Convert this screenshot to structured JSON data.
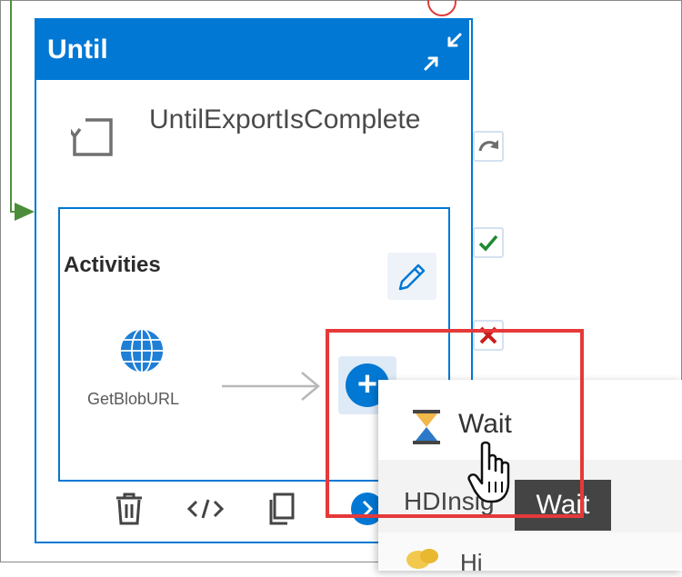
{
  "card": {
    "header_title": "Until",
    "activity_name": "UntilExportIsComplete",
    "activities_heading": "Activities",
    "inner_activity_label": "GetBlobURL"
  },
  "menu": {
    "items": [
      {
        "label": "Wait",
        "icon": "hourglass-icon"
      },
      {
        "label": "HDInsig",
        "icon": "hdinsight-icon"
      },
      {
        "label": "Hi",
        "icon": "hive-icon"
      }
    ],
    "tooltip": "Wait"
  },
  "colors": {
    "accent": "#0078d4",
    "flow_green": "#4b8d3a",
    "highlight_red": "#e5393a"
  },
  "icons": {
    "collapse": "collapse-icon",
    "loop": "loop-icon",
    "edit": "pencil-icon",
    "activity": "globe-icon",
    "add": "plus-icon",
    "footer": [
      "trash-icon",
      "code-icon",
      "copy-icon",
      "arrow-right-circle-icon"
    ],
    "side": [
      "redo-icon",
      "check-icon",
      "x-icon"
    ]
  }
}
